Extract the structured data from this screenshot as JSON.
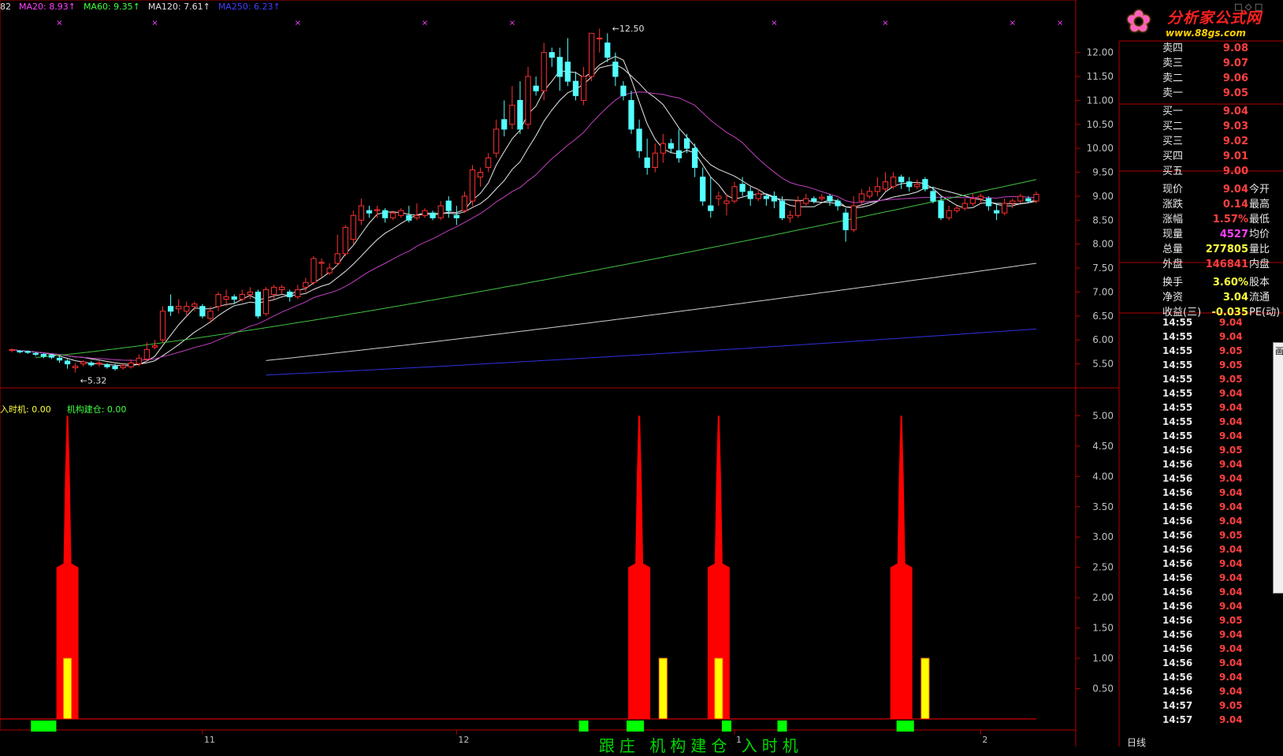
{
  "ma_legend": [
    {
      "text": "82",
      "color": "#e0e0e0"
    },
    {
      "text": "MA20: 8.93↑",
      "color": "#ff40ff"
    },
    {
      "text": "MA60: 9.35↑",
      "color": "#40ff40"
    },
    {
      "text": "MA120: 7.61↑",
      "color": "#e0e0e0"
    },
    {
      "text": "MA250: 6.23↑",
      "color": "#4040ff"
    }
  ],
  "indicator_legend": [
    {
      "text": "入时机: 0.00",
      "color": "#ffff40"
    },
    {
      "text": "机构建仓: 0.00",
      "color": "#40ff40"
    }
  ],
  "watermark": {
    "flower": "✿",
    "title": "分析家公式网",
    "url": "www.88gs.com"
  },
  "window_buttons": "□ ◇ □",
  "quote": [
    {
      "label": "卖四",
      "value": "9.08",
      "value_color": "#ff4040"
    },
    {
      "label": "卖三",
      "value": "9.07",
      "value_color": "#ff4040"
    },
    {
      "label": "卖二",
      "value": "9.06",
      "value_color": "#ff4040"
    },
    {
      "label": "卖一",
      "value": "9.05",
      "value_color": "#ff4040"
    },
    {
      "label": "买一",
      "value": "9.04",
      "value_color": "#ff4040"
    },
    {
      "label": "买二",
      "value": "9.03",
      "value_color": "#ff4040"
    },
    {
      "label": "买三",
      "value": "9.02",
      "value_color": "#ff4040"
    },
    {
      "label": "买四",
      "value": "9.01",
      "value_color": "#ff4040"
    },
    {
      "label": "买五",
      "value": "9.00",
      "value_color": "#ff4040"
    },
    {
      "label": "现价",
      "value": "9.04",
      "value_color": "#ff4040",
      "label2": "今开"
    },
    {
      "label": "涨跌",
      "value": "0.14",
      "value_color": "#ff4040",
      "label2": "最高"
    },
    {
      "label": "涨幅",
      "value": "1.57%",
      "value_color": "#ff4040",
      "label2": "最低"
    },
    {
      "label": "现量",
      "value": "4527",
      "value_color": "#ff40ff",
      "label2": "均价"
    },
    {
      "label": "总量",
      "value": "277805",
      "value_color": "#ffff40",
      "label2": "量比"
    },
    {
      "label": "外盘",
      "value": "146841",
      "value_color": "#ff4040",
      "label2": "内盘"
    },
    {
      "label": "换手",
      "value": "3.60%",
      "value_color": "#ffff40",
      "label2": "股本"
    },
    {
      "label": "净资",
      "value": "3.04",
      "value_color": "#ffff40",
      "label2": "流通"
    },
    {
      "label": "收益(三)",
      "value": "-0.035",
      "value_color": "#ffff40",
      "label2": "PE(动)"
    }
  ],
  "ticks": [
    {
      "time": "14:55",
      "price": "9.04"
    },
    {
      "time": "14:55",
      "price": "9.04"
    },
    {
      "time": "14:55",
      "price": "9.05"
    },
    {
      "time": "14:55",
      "price": "9.05"
    },
    {
      "time": "14:55",
      "price": "9.05"
    },
    {
      "time": "14:55",
      "price": "9.04"
    },
    {
      "time": "14:55",
      "price": "9.04"
    },
    {
      "time": "14:55",
      "price": "9.04"
    },
    {
      "time": "14:55",
      "price": "9.04"
    },
    {
      "time": "14:56",
      "price": "9.05"
    },
    {
      "time": "14:56",
      "price": "9.04"
    },
    {
      "time": "14:56",
      "price": "9.04"
    },
    {
      "time": "14:56",
      "price": "9.04"
    },
    {
      "time": "14:56",
      "price": "9.04"
    },
    {
      "time": "14:56",
      "price": "9.04"
    },
    {
      "time": "14:56",
      "price": "9.05"
    },
    {
      "time": "14:56",
      "price": "9.04"
    },
    {
      "time": "14:56",
      "price": "9.04"
    },
    {
      "time": "14:56",
      "price": "9.04"
    },
    {
      "time": "14:56",
      "price": "9.04"
    },
    {
      "time": "14:56",
      "price": "9.04"
    },
    {
      "time": "14:56",
      "price": "9.05"
    },
    {
      "time": "14:56",
      "price": "9.04"
    },
    {
      "time": "14:56",
      "price": "9.04"
    },
    {
      "time": "14:56",
      "price": "9.04"
    },
    {
      "time": "14:56",
      "price": "9.04"
    },
    {
      "time": "14:56",
      "price": "9.04"
    },
    {
      "time": "14:57",
      "price": "9.05"
    },
    {
      "time": "14:57",
      "price": "9.04"
    }
  ],
  "popup_glyph": "画",
  "period_label": "日线",
  "bottom_text": "跟庄 机构建仓 入时机",
  "x_labels": [
    {
      "text": "11",
      "x_bar": 24
    },
    {
      "text": "12",
      "x_bar": 56
    },
    {
      "text": "1",
      "x_bar": 91
    },
    {
      "text": "2",
      "x_bar": 122
    }
  ],
  "chart_data": [
    {
      "type": "candlestick",
      "y_range": [
        5.0,
        12.8
      ],
      "y_ticks": [
        "12.00",
        "11.50",
        "11.00",
        "10.50",
        "10.00",
        "9.50",
        "9.00",
        "8.50",
        "8.00",
        "7.50",
        "7.00",
        "6.50",
        "6.00",
        "5.50"
      ],
      "annotations": [
        {
          "text": "12.50",
          "bar": 75,
          "price": 12.5
        },
        {
          "text": "5.32",
          "bar": 8,
          "price": 5.32
        }
      ],
      "colors": {
        "up": "#ff3030",
        "down": "#54ffff"
      },
      "candles": [
        [
          5.78,
          5.8,
          5.74,
          5.82
        ],
        [
          5.77,
          5.75,
          5.72,
          5.79
        ],
        [
          5.76,
          5.74,
          5.71,
          5.78
        ],
        [
          5.72,
          5.7,
          5.66,
          5.74
        ],
        [
          5.7,
          5.66,
          5.62,
          5.72
        ],
        [
          5.68,
          5.64,
          5.6,
          5.7
        ],
        [
          5.62,
          5.58,
          5.52,
          5.66
        ],
        [
          5.56,
          5.5,
          5.4,
          5.6
        ],
        [
          5.42,
          5.45,
          5.32,
          5.52
        ],
        [
          5.5,
          5.54,
          5.45,
          5.58
        ],
        [
          5.52,
          5.48,
          5.44,
          5.56
        ],
        [
          5.5,
          5.52,
          5.44,
          5.56
        ],
        [
          5.48,
          5.44,
          5.4,
          5.52
        ],
        [
          5.45,
          5.4,
          5.36,
          5.5
        ],
        [
          5.42,
          5.46,
          5.38,
          5.52
        ],
        [
          5.44,
          5.52,
          5.4,
          5.6
        ],
        [
          5.5,
          5.62,
          5.45,
          5.7
        ],
        [
          5.6,
          5.8,
          5.55,
          5.95
        ],
        [
          5.85,
          5.88,
          5.8,
          6.0
        ],
        [
          6.0,
          6.6,
          5.95,
          6.7
        ],
        [
          6.7,
          6.6,
          6.5,
          6.95
        ],
        [
          6.65,
          6.7,
          6.55,
          6.85
        ],
        [
          6.6,
          6.7,
          6.5,
          6.8
        ],
        [
          6.7,
          6.75,
          6.6,
          6.8
        ],
        [
          6.7,
          6.5,
          6.45,
          6.75
        ],
        [
          6.45,
          6.6,
          6.35,
          6.7
        ],
        [
          6.7,
          6.95,
          6.6,
          7.0
        ],
        [
          6.85,
          6.9,
          6.7,
          7.05
        ],
        [
          6.9,
          6.85,
          6.75,
          6.95
        ],
        [
          6.85,
          6.95,
          6.8,
          7.05
        ],
        [
          6.95,
          7.0,
          6.85,
          7.1
        ],
        [
          7.0,
          6.5,
          6.45,
          7.05
        ],
        [
          6.55,
          7.05,
          6.5,
          7.1
        ],
        [
          6.95,
          7.1,
          6.85,
          7.15
        ],
        [
          7.05,
          7.1,
          6.95,
          7.15
        ],
        [
          7.0,
          6.9,
          6.8,
          7.05
        ],
        [
          6.9,
          7.05,
          6.85,
          7.15
        ],
        [
          7.1,
          7.2,
          7.0,
          7.3
        ],
        [
          7.2,
          7.7,
          7.15,
          7.75
        ],
        [
          7.6,
          7.62,
          7.3,
          7.7
        ],
        [
          7.4,
          7.5,
          7.35,
          7.6
        ],
        [
          7.6,
          7.8,
          7.55,
          8.2
        ],
        [
          7.8,
          8.35,
          7.75,
          8.4
        ],
        [
          8.1,
          8.6,
          8.0,
          8.7
        ],
        [
          8.5,
          8.8,
          8.4,
          8.95
        ],
        [
          8.7,
          8.65,
          8.55,
          8.8
        ],
        [
          8.7,
          8.72,
          8.55,
          8.8
        ],
        [
          8.7,
          8.55,
          8.45,
          8.75
        ],
        [
          8.55,
          8.65,
          8.5,
          8.7
        ],
        [
          8.6,
          8.7,
          8.55,
          8.75
        ],
        [
          8.6,
          8.5,
          8.45,
          8.8
        ],
        [
          8.55,
          8.6,
          8.5,
          8.85
        ],
        [
          8.6,
          8.7,
          8.55,
          8.75
        ],
        [
          8.65,
          8.55,
          8.5,
          8.7
        ],
        [
          8.55,
          8.8,
          8.5,
          8.9
        ],
        [
          8.9,
          8.7,
          8.55,
          9.0
        ],
        [
          8.6,
          8.55,
          8.4,
          8.8
        ],
        [
          8.7,
          9.0,
          8.65,
          9.1
        ],
        [
          8.9,
          9.55,
          8.8,
          9.65
        ],
        [
          9.4,
          9.5,
          9.2,
          9.6
        ],
        [
          9.6,
          9.8,
          9.5,
          9.9
        ],
        [
          9.9,
          10.4,
          9.8,
          10.6
        ],
        [
          10.6,
          10.4,
          10.25,
          11.0
        ],
        [
          10.5,
          10.9,
          10.4,
          11.3
        ],
        [
          11.0,
          10.4,
          10.3,
          11.4
        ],
        [
          10.5,
          11.5,
          10.4,
          11.7
        ],
        [
          11.3,
          11.2,
          11.1,
          11.5
        ],
        [
          11.2,
          12.0,
          11.0,
          12.2
        ],
        [
          12.0,
          11.9,
          11.7,
          12.1
        ],
        [
          11.9,
          11.5,
          11.2,
          12.1
        ],
        [
          11.8,
          11.4,
          11.3,
          12.3
        ],
        [
          11.4,
          11.1,
          11.0,
          11.6
        ],
        [
          11.0,
          11.5,
          10.9,
          11.7
        ],
        [
          11.5,
          12.4,
          11.4,
          12.4
        ],
        [
          12.3,
          12.3,
          12.0,
          12.5
        ],
        [
          12.2,
          11.9,
          11.8,
          12.4
        ],
        [
          11.8,
          11.5,
          11.3,
          12.0
        ],
        [
          11.3,
          11.1,
          11.0,
          11.4
        ],
        [
          11.0,
          10.4,
          10.3,
          11.2
        ],
        [
          10.4,
          9.95,
          9.8,
          10.6
        ],
        [
          9.8,
          9.6,
          9.45,
          10.2
        ],
        [
          9.6,
          9.9,
          9.5,
          10.1
        ],
        [
          9.9,
          10.1,
          9.7,
          10.3
        ],
        [
          10.1,
          10.0,
          9.9,
          10.2
        ],
        [
          9.95,
          9.8,
          9.7,
          10.4
        ],
        [
          10.2,
          10.0,
          9.9,
          10.3
        ],
        [
          10.0,
          9.6,
          9.4,
          10.1
        ],
        [
          9.4,
          8.9,
          8.8,
          9.6
        ],
        [
          8.8,
          8.7,
          8.55,
          9.4
        ],
        [
          8.95,
          9.0,
          8.8,
          9.1
        ],
        [
          8.85,
          8.9,
          8.6,
          9.05
        ],
        [
          8.9,
          9.2,
          8.85,
          9.3
        ],
        [
          9.25,
          9.1,
          9.0,
          9.4
        ],
        [
          9.1,
          8.95,
          8.8,
          9.2
        ],
        [
          8.95,
          9.05,
          8.9,
          9.15
        ],
        [
          9.0,
          8.95,
          8.8,
          9.05
        ],
        [
          9.0,
          8.9,
          8.75,
          9.1
        ],
        [
          8.9,
          8.55,
          8.5,
          9.0
        ],
        [
          8.55,
          8.6,
          8.45,
          8.7
        ],
        [
          8.6,
          8.9,
          8.55,
          9.0
        ],
        [
          8.85,
          8.95,
          8.8,
          9.05
        ],
        [
          8.95,
          8.9,
          8.85,
          9.0
        ],
        [
          8.95,
          8.98,
          8.9,
          9.05
        ],
        [
          9.0,
          8.9,
          8.8,
          9.05
        ],
        [
          8.9,
          8.8,
          8.7,
          8.95
        ],
        [
          8.65,
          8.3,
          8.05,
          8.75
        ],
        [
          8.3,
          8.8,
          8.25,
          9.0
        ],
        [
          8.9,
          9.05,
          8.8,
          9.15
        ],
        [
          9.0,
          9.1,
          8.95,
          9.2
        ],
        [
          9.1,
          9.2,
          9.0,
          9.4
        ],
        [
          9.15,
          9.3,
          9.1,
          9.5
        ],
        [
          9.2,
          9.4,
          9.15,
          9.5
        ],
        [
          9.4,
          9.3,
          9.15,
          9.45
        ],
        [
          9.3,
          9.2,
          9.1,
          9.4
        ],
        [
          9.2,
          9.25,
          9.15,
          9.35
        ],
        [
          9.35,
          9.15,
          9.1,
          9.4
        ],
        [
          9.1,
          8.9,
          8.85,
          9.2
        ],
        [
          8.9,
          8.55,
          8.5,
          9.0
        ],
        [
          8.55,
          8.7,
          8.5,
          8.8
        ],
        [
          8.7,
          8.75,
          8.65,
          8.8
        ],
        [
          8.75,
          8.85,
          8.7,
          8.95
        ],
        [
          8.85,
          8.95,
          8.8,
          9.05
        ],
        [
          8.95,
          9.0,
          8.85,
          9.05
        ],
        [
          8.95,
          8.8,
          8.7,
          9.0
        ],
        [
          8.7,
          8.65,
          8.5,
          8.85
        ],
        [
          8.65,
          8.85,
          8.6,
          8.95
        ],
        [
          8.85,
          8.9,
          8.75,
          8.95
        ],
        [
          8.9,
          9.0,
          8.85,
          9.05
        ],
        [
          8.95,
          8.9,
          8.85,
          9.0
        ],
        [
          8.9,
          9.04,
          8.85,
          9.1
        ]
      ],
      "ma_lines": [
        {
          "name": "MA5",
          "color": "#e0e0e0"
        },
        {
          "name": "MA10",
          "color": "#e0e0e0"
        },
        {
          "name": "MA20",
          "color": "#c040c0"
        },
        {
          "name": "MA60",
          "color": "#40c040"
        },
        {
          "name": "MA120",
          "color": "#d0d0d0"
        },
        {
          "name": "MA250",
          "color": "#3030e0"
        }
      ],
      "x_markers": [
        6,
        18,
        36,
        52,
        63,
        96,
        110,
        126,
        132
      ]
    },
    {
      "type": "bar",
      "y_range": [
        0,
        5.2
      ],
      "y_ticks": [
        "5.00",
        "4.50",
        "4.00",
        "3.50",
        "3.00",
        "2.50",
        "2.00",
        "1.50",
        "1.00",
        "0.50"
      ],
      "spikes": [
        {
          "bar": 7,
          "peak": 5.0,
          "yellow_bar": 7
        },
        {
          "bar": 79,
          "peak": 5.0,
          "yellow_bar": 82
        },
        {
          "bar": 89,
          "peak": 5.0,
          "yellow_bar": 89
        },
        {
          "bar": 112,
          "peak": 5.0,
          "yellow_bar": 115
        }
      ],
      "green_markers": [
        3,
        4,
        5,
        72,
        78,
        79,
        90,
        97,
        112,
        113
      ]
    }
  ]
}
